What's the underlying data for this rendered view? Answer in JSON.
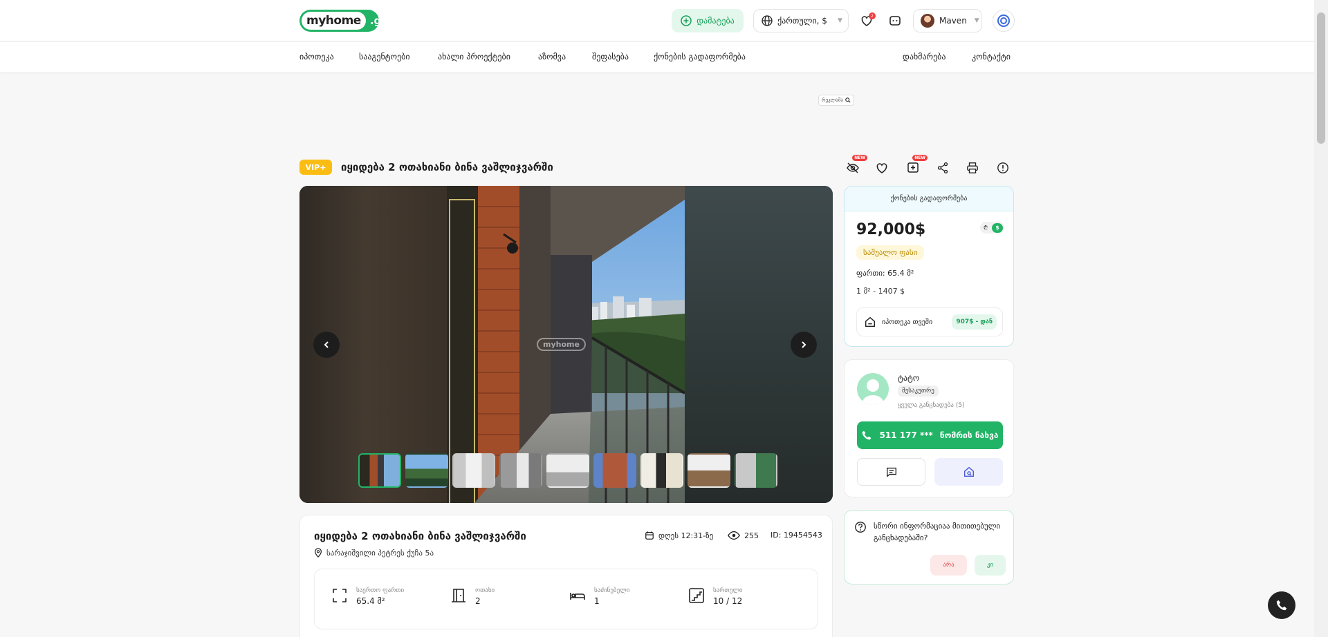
{
  "header": {
    "logo_left": "myhome",
    "logo_right": ".ge",
    "add_label": "დამატება",
    "lang_label": "ქართული, $",
    "notif_count": "2",
    "user_name": "Maven"
  },
  "nav": {
    "left": [
      "იპოთეკა",
      "სააგენტოები",
      "ახალი პროექტები",
      "აზომვა",
      "შეფასება",
      "ქონების გადაფორმება"
    ],
    "right": [
      "დახმარება",
      "კონტაქტი"
    ]
  },
  "ad": {
    "label": "რეკლამა"
  },
  "listing": {
    "badge": "VIP+",
    "title": "იყიდება 2 ოთახიანი ბინა ვაშლიჯვარში",
    "new_label": "NEW",
    "watermark": "myhome",
    "thumb_count": 9
  },
  "price_card": {
    "header": "ქონების გადაფორმება",
    "price": "92,000$",
    "cur_lari": "₾",
    "cur_usd": "$",
    "avg_label": "საშუალო ფასი",
    "area": "ფართი: 65.4 მ²",
    "sqm_price": "1 მ² - 1407 $",
    "mortgage_label": "იპოთეკა თვეში",
    "mortgage_value": "907$ - დან"
  },
  "agent": {
    "name": "ტატო",
    "role": "მესაკუთრე",
    "all_listings": "ყველა განცხადება (5)",
    "call_number": "511 177 ***",
    "call_label": "ნომრის ნახვა"
  },
  "feedback": {
    "question": "სწორი ინფორმაციაა მითითებული განცხადებაში?",
    "no": "არა",
    "yes": "კი"
  },
  "details": {
    "title": "იყიდება 2 ოთახიანი ბინა ვაშლიჯვარში",
    "date": "დღეს 12:31-ზე",
    "views": "255",
    "id": "ID: 19454543",
    "address": "სარაჯიშვილი პეტრეს ქუჩა 5ა",
    "features": [
      {
        "label": "საერთო ფართი",
        "value": "65.4 მ²",
        "icon": "area-icon"
      },
      {
        "label": "ოთახი",
        "value": "2",
        "icon": "door-icon"
      },
      {
        "label": "საძინებელი",
        "value": "1",
        "icon": "bed-icon"
      },
      {
        "label": "სართული",
        "value": "10 / 12",
        "icon": "stairs-icon"
      }
    ]
  },
  "colors": {
    "brand_green": "#22b466",
    "vip_yellow": "#fbbd14",
    "new_red": "#f03d3d"
  }
}
